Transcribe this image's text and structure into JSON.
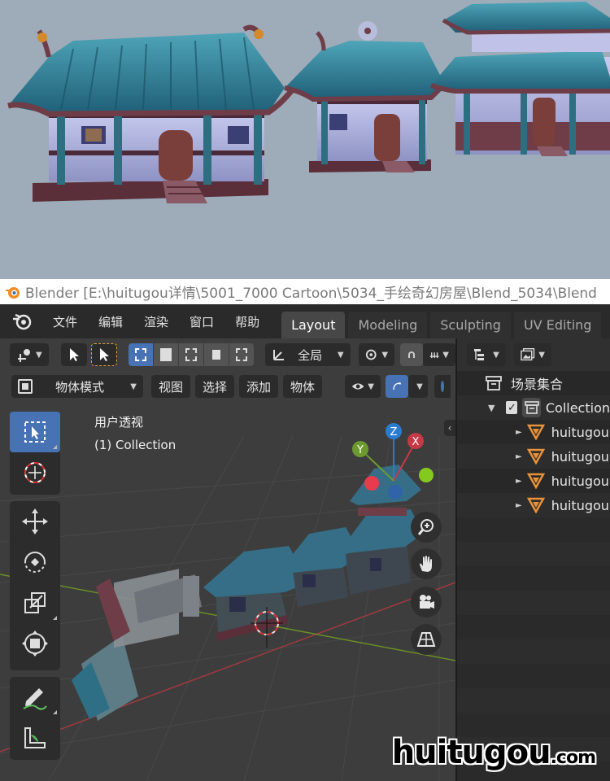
{
  "titlebar": {
    "text": "Blender [E:\\huitugou详情\\5001_7000 Cartoon\\5034_手绘奇幻房屋\\Blend_5034\\Blend"
  },
  "menu": {
    "file": "文件",
    "edit": "编辑",
    "render": "渲染",
    "window": "窗口",
    "help": "帮助"
  },
  "workspaces": [
    "Layout",
    "Modeling",
    "Sculpting",
    "UV Editing"
  ],
  "viewport": {
    "transform_orientation": "全局",
    "mode": "物体模式",
    "menus": {
      "view": "视图",
      "select": "选择",
      "add": "添加",
      "object": "物体"
    },
    "view_name": "用户透视",
    "collection_label": "(1) Collection",
    "gizmo": {
      "z": "Z",
      "y": "Y",
      "x": "X"
    }
  },
  "outliner": {
    "scene_collection": "场景集合",
    "collection": "Collection",
    "objects": [
      "huitugou",
      "huitugou",
      "huitugou",
      "huitugou"
    ]
  },
  "watermark": {
    "main": "huitugou",
    "suffix": ".com"
  },
  "colors": {
    "accent": "#4772b3",
    "roof": "#2f7e93",
    "timber": "#6e3d48",
    "wall": "#b6b9de"
  }
}
